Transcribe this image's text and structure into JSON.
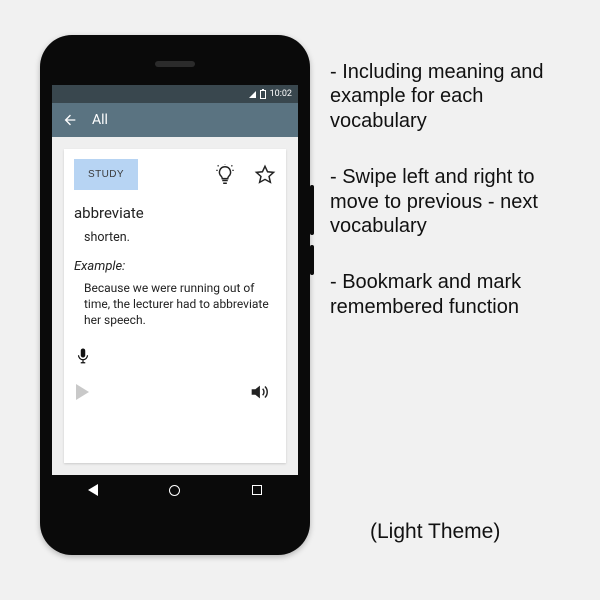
{
  "statusbar": {
    "time": "10:02"
  },
  "appbar": {
    "title": "All"
  },
  "card": {
    "study_label": "STUDY",
    "word": "abbreviate",
    "meaning": "shorten.",
    "example_label": "Example:",
    "example_text": "Because we were running out of time, the lecturer had to abbreviate her speech."
  },
  "marketing": {
    "b1": "- Including meaning and example for each vocabulary",
    "b2": "- Swipe left and right to move to previous - next vocabulary",
    "b3": "- Bookmark and mark remembered function",
    "theme": "(Light Theme)"
  }
}
